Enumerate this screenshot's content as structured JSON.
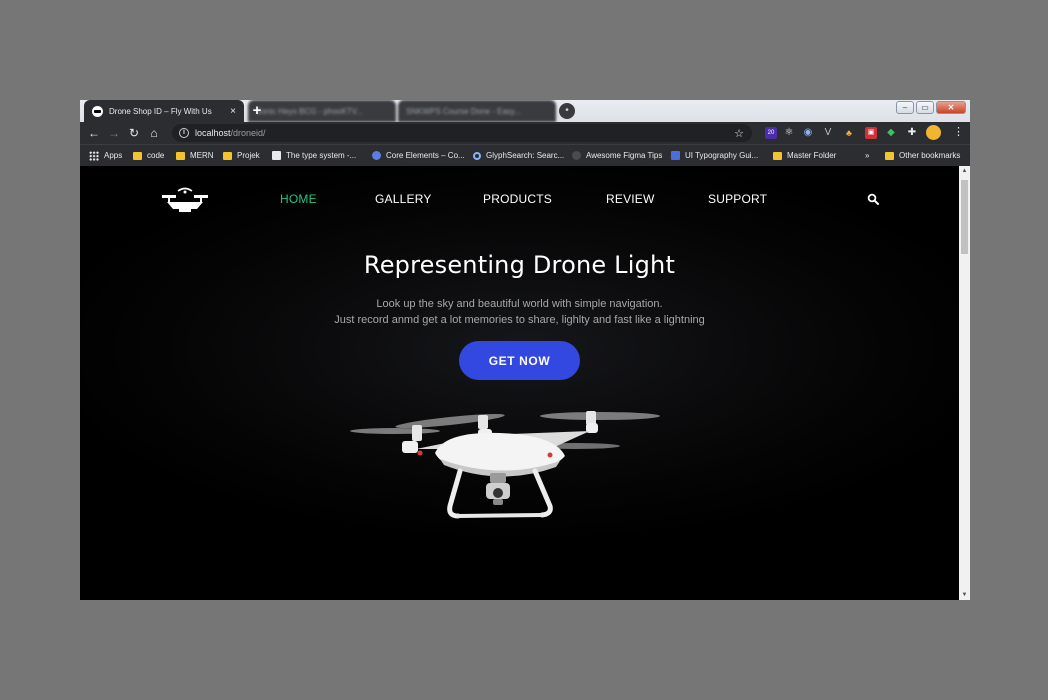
{
  "browser": {
    "tabs": [
      {
        "title": "Drone Shop ID – Fly With Us",
        "active": true
      },
      {
        "title": "Sonic Heyo BCG - phooKTV...",
        "active": false
      },
      {
        "title": "SNKWPS Course Done - Easy...",
        "active": false
      }
    ],
    "close_glyph": "×",
    "new_tab_glyph": "+",
    "address": {
      "host": "localhost",
      "path": "/droneid/"
    },
    "extension_badge": "20",
    "bookmarks": [
      {
        "label": "Apps",
        "icon": "apps-grid-icon"
      },
      {
        "label": "code",
        "icon": "folder-icon"
      },
      {
        "label": "MERN",
        "icon": "folder-icon"
      },
      {
        "label": "Projek",
        "icon": "folder-icon"
      },
      {
        "label": "The type system -...",
        "icon": "page-icon"
      },
      {
        "label": "Core Elements – Co...",
        "icon": "globe-icon"
      },
      {
        "label": "GlyphSearch: Searc...",
        "icon": "search-icon"
      },
      {
        "label": "Awesome Figma Tips",
        "icon": "figma-icon"
      },
      {
        "label": "UI Typography Gui...",
        "icon": "abc-icon"
      },
      {
        "label": "Master Folder",
        "icon": "folder-icon"
      }
    ],
    "overflow": "»",
    "other_bookmarks": "Other bookmarks"
  },
  "site": {
    "nav": [
      {
        "label": "HOME",
        "active": true
      },
      {
        "label": "GALLERY",
        "active": false
      },
      {
        "label": "PRODUCTS",
        "active": false
      },
      {
        "label": "REVIEW",
        "active": false
      },
      {
        "label": "SUPPORT",
        "active": false
      }
    ],
    "hero": {
      "title": "Representing Drone Light",
      "line1": "Look up the sky and beautiful world with simple navigation.",
      "line2": "Just record anmd get a lot memories to share, lighlty and fast like a lightning",
      "cta": "GET NOW"
    }
  },
  "colors": {
    "accent_green": "#25c482",
    "cta_blue": "#3348e0",
    "page_bg": "#000000"
  }
}
